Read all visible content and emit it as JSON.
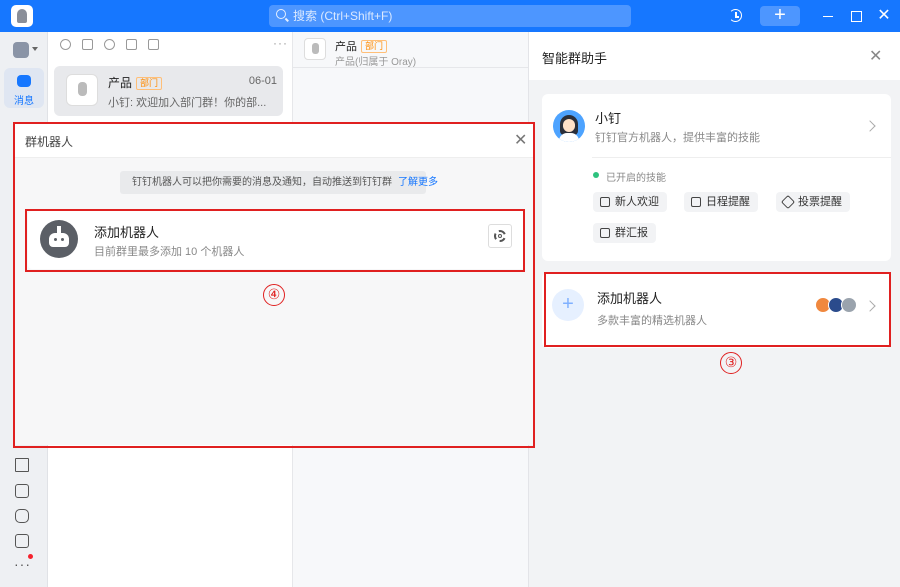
{
  "titlebar": {
    "search_placeholder": "搜索 (Ctrl+Shift+F)",
    "plus_label": "+",
    "close_label": "✕",
    "accent_color": "#1677ff"
  },
  "leftnav": {
    "active_label": "消息",
    "more_label": "···"
  },
  "conversation_list": {
    "more_label": "···",
    "items": [
      {
        "name": "产品",
        "tag": "部门",
        "time": "06-01",
        "preview": "小钉: 欢迎加入部门群！你的部..."
      }
    ]
  },
  "chat": {
    "title": "产品",
    "tag": "部门",
    "subtitle": "产品(归属于 Oray)"
  },
  "assistant_panel": {
    "title": "智能群助手",
    "close_label": "✕",
    "bot": {
      "name": "小钉",
      "description": "钉钉官方机器人，提供丰富的技能"
    },
    "skills_label": "已开启的技能",
    "skills": [
      "新人欢迎",
      "日程提醒",
      "投票提醒",
      "群汇报"
    ],
    "add_robot": {
      "title": "添加机器人",
      "description": "多款丰富的精选机器人",
      "plus": "+"
    }
  },
  "robot_dialog": {
    "title": "群机器人",
    "close_label": "✕",
    "notice_text": "钉钉机器人可以把你需要的消息及通知，自动推送到钉钉群",
    "notice_link": "了解更多",
    "add_robot": {
      "title": "添加机器人",
      "description": "目前群里最多添加 10 个机器人"
    }
  },
  "annotations": {
    "callout_3": "③",
    "callout_4": "④",
    "color": "#e02020"
  }
}
